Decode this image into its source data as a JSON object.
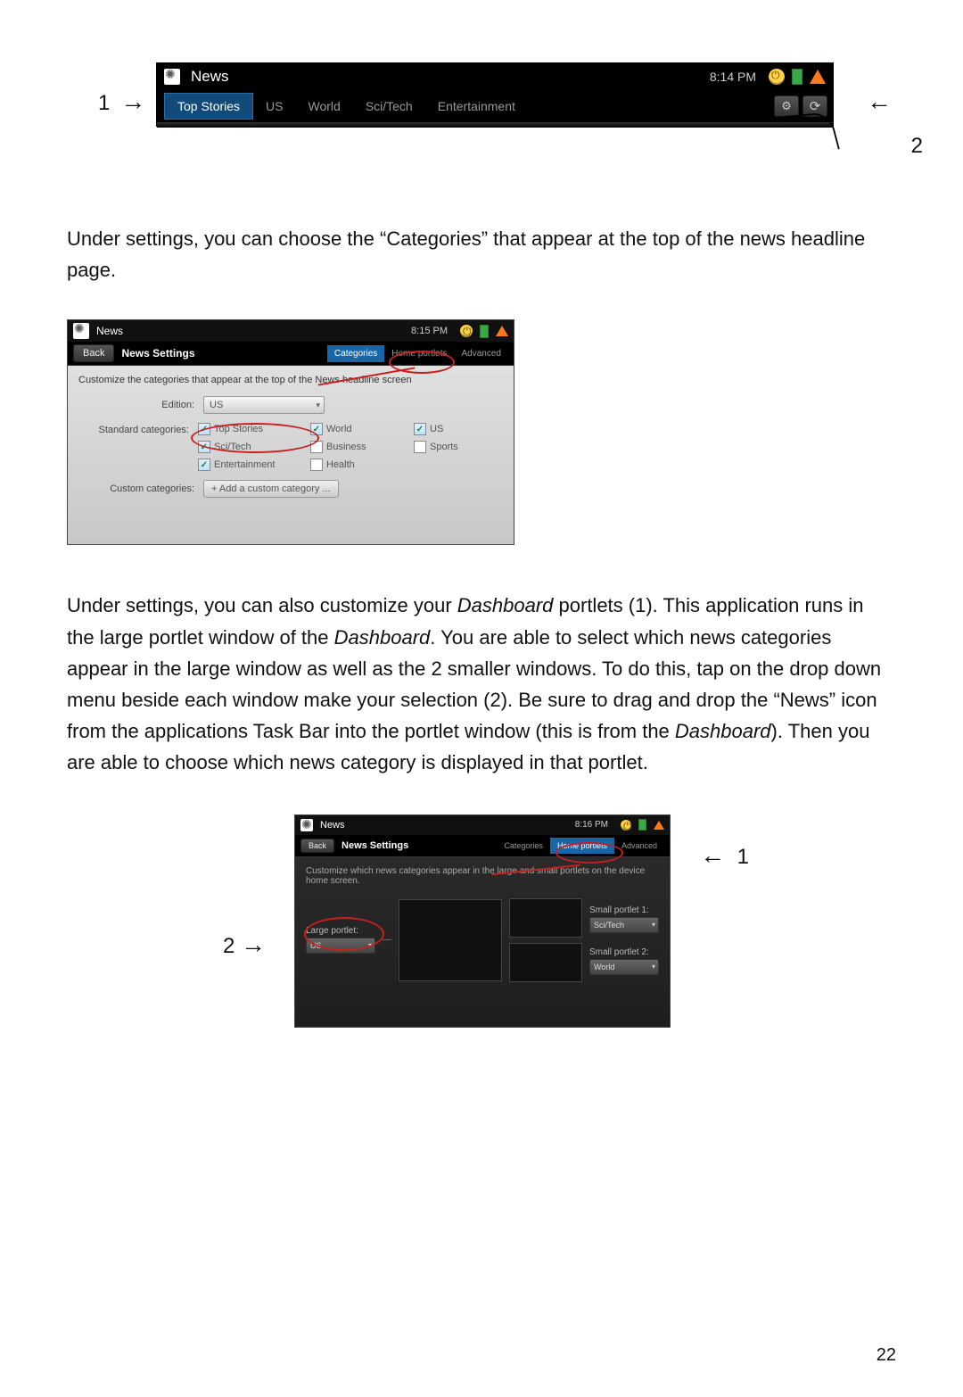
{
  "shot1": {
    "title": "News",
    "time": "8:14 PM",
    "tabs": [
      "Top Stories",
      "US",
      "World",
      "Sci/Tech",
      "Entertainment"
    ],
    "selected": 0,
    "annot": {
      "left": "1",
      "right": "2"
    }
  },
  "para1": "Under settings, you can choose the “Categories” that appear at the top of the news headline page.",
  "shot2": {
    "title": "News",
    "time": "8:15 PM",
    "back": "Back",
    "settings_title": "News Settings",
    "tabs": [
      "Categories",
      "Home portlets",
      "Advanced"
    ],
    "selected_tab": 0,
    "desc": "Customize the categories that appear at the top of the News headline screen",
    "edition_label": "Edition:",
    "edition_value": "US",
    "std_label": "Standard categories:",
    "categories": [
      {
        "label": "Top Stories",
        "checked": true
      },
      {
        "label": "World",
        "checked": true
      },
      {
        "label": "US",
        "checked": true
      },
      {
        "label": "Sci/Tech",
        "checked": true
      },
      {
        "label": "Business",
        "checked": false
      },
      {
        "label": "Sports",
        "checked": false
      },
      {
        "label": "Entertainment",
        "checked": true
      },
      {
        "label": "Health",
        "checked": false
      }
    ],
    "custom_label": "Custom categories:",
    "add_btn": "+  Add a custom category ..."
  },
  "para2_parts": {
    "a": "Under settings, you can also customize your ",
    "b": "Dashboard",
    "c": " portlets (1). This application runs in the large portlet window of the ",
    "d": "Dashboard",
    "e": ". You are able to select which news categories appear in the large window as well as the 2 smaller windows.    To do this, tap on the drop down menu beside each window make your selection (2).    Be sure to drag and drop the “News” icon from the applications Task Bar into the portlet window (this is from the ",
    "f": "Dashboard",
    "g": ").    Then you are able to choose which news category is displayed in that portlet."
  },
  "shot3": {
    "title": "News",
    "time": "8:16 PM",
    "back": "Back",
    "settings_title": "News Settings",
    "tabs": [
      "Categories",
      "Home portlets",
      "Advanced"
    ],
    "selected_tab": 1,
    "desc": "Customize which news categories appear in the large and small portlets on the device home screen.",
    "large_label": "Large portlet:",
    "large_value": "US",
    "small1_label": "Small portlet 1:",
    "small1_value": "Sci/Tech",
    "small2_label": "Small portlet 2:",
    "small2_value": "World",
    "annot": {
      "right": "1",
      "left": "2"
    }
  },
  "page_number": "22"
}
